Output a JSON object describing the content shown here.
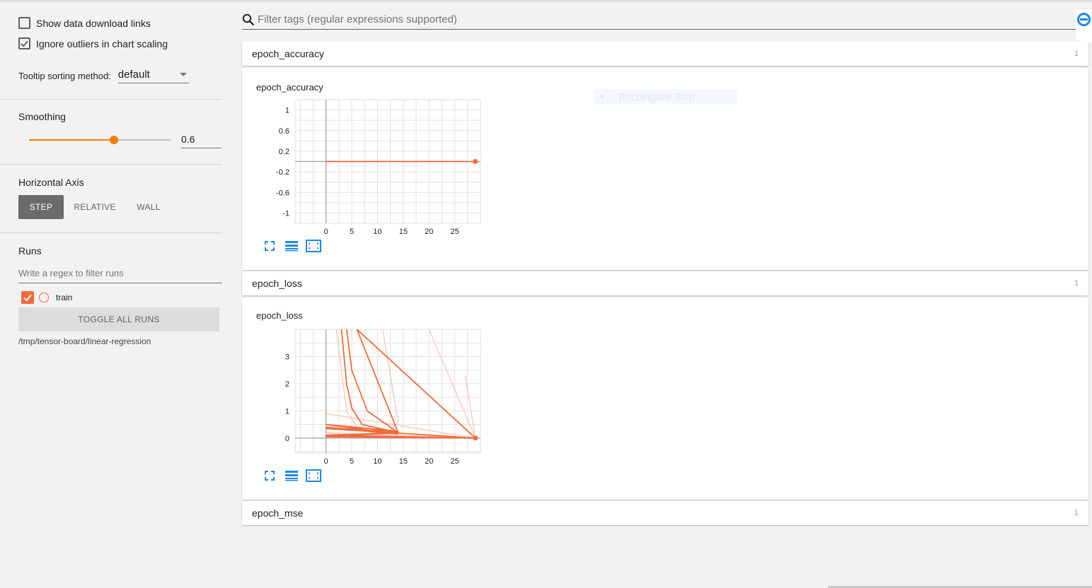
{
  "sidebar": {
    "show_download_links": {
      "label": "Show data download links",
      "checked": false
    },
    "ignore_outliers": {
      "label": "Ignore outliers in chart scaling",
      "checked": true
    },
    "tooltip_sorting": {
      "label": "Tooltip sorting method:",
      "value": "default"
    },
    "smoothing": {
      "label": "Smoothing",
      "value": "0.6",
      "fraction": 0.6
    },
    "horizontal_axis": {
      "label": "Horizontal Axis",
      "options": [
        "STEP",
        "RELATIVE",
        "WALL"
      ],
      "selected": "STEP"
    },
    "runs": {
      "label": "Runs",
      "filter_placeholder": "Write a regex to filter runs",
      "items": [
        {
          "name": "train",
          "checked": true,
          "color": "#f26b3a"
        }
      ],
      "toggle_all_label": "TOGGLE ALL RUNS",
      "logdir": "/tmp/tensor-board/linear-regression"
    }
  },
  "search": {
    "placeholder": "Filter tags (regular expressions supported)"
  },
  "overlay": {
    "snip_label": "Rectangular Snip"
  },
  "categories": [
    {
      "name": "epoch_accuracy",
      "count": "1"
    },
    {
      "name": "epoch_loss",
      "count": "1"
    },
    {
      "name": "epoch_mse",
      "count": "1"
    }
  ],
  "colors": {
    "accent": "#f57c00",
    "run": "#f26b3a",
    "action_icons": "#1e88e5"
  },
  "icons": [
    "search-icon",
    "expand-icon",
    "list-icon",
    "fit-domain-icon"
  ],
  "chart_data": [
    {
      "type": "line",
      "title": "epoch_accuracy",
      "xlim": [
        -6,
        30
      ],
      "ylim": [
        -1.2,
        1.2
      ],
      "x_ticks": [
        0,
        5,
        10,
        15,
        20,
        25
      ],
      "y_ticks": [
        1,
        0.6,
        0.2,
        -0.2,
        -0.6,
        -1
      ],
      "y_tick_labels": [
        "1",
        "0.6",
        "0.2",
        "-0.2",
        "-0.6",
        "-1"
      ],
      "grid": true,
      "series": [
        {
          "style": "smoothed",
          "x": [
            0,
            29
          ],
          "y": [
            0,
            0
          ]
        }
      ]
    },
    {
      "type": "line",
      "title": "epoch_loss",
      "xlim": [
        -6,
        30
      ],
      "ylim": [
        -0.55,
        4.0
      ],
      "x_ticks": [
        0,
        5,
        10,
        15,
        20,
        25
      ],
      "y_ticks": [
        3,
        2,
        1,
        0
      ],
      "y_tick_labels": [
        "3",
        "2",
        "1",
        "0"
      ],
      "grid": true,
      "series": [
        {
          "style": "raw",
          "x": [
            2,
            4,
            6,
            9,
            14,
            0,
            29
          ],
          "y": [
            4.0,
            1.0,
            0.4,
            0.2,
            0.1,
            0.2,
            0.0
          ]
        },
        {
          "style": "raw",
          "x": [
            11,
            14,
            12,
            0,
            29
          ],
          "y": [
            4.0,
            0.6,
            0.2,
            0.35,
            0.0
          ]
        },
        {
          "style": "raw",
          "x": [
            20,
            29,
            0,
            14
          ],
          "y": [
            4.0,
            0.0,
            0.15,
            0.1
          ]
        },
        {
          "style": "raw",
          "x": [
            27,
            29,
            0
          ],
          "y": [
            2.3,
            0.0,
            0.9
          ]
        },
        {
          "style": "smoothed",
          "x": [
            3,
            4,
            5,
            7,
            14,
            0,
            14
          ],
          "y": [
            4.0,
            2.0,
            1.1,
            0.5,
            0.2,
            0.4,
            0.15
          ]
        },
        {
          "style": "smoothed",
          "x": [
            4,
            5,
            8,
            14,
            0,
            29
          ],
          "y": [
            4.0,
            2.5,
            1.0,
            0.2,
            0.1,
            0.0
          ]
        },
        {
          "style": "smoothed",
          "x": [
            6,
            14,
            0,
            29
          ],
          "y": [
            4.0,
            0.2,
            0.05,
            0.0
          ]
        },
        {
          "style": "smoothed",
          "x": [
            6,
            29,
            0,
            14,
            0,
            14
          ],
          "y": [
            4.0,
            0.0,
            0.35,
            0.25,
            0.5,
            0.15
          ]
        }
      ]
    }
  ]
}
